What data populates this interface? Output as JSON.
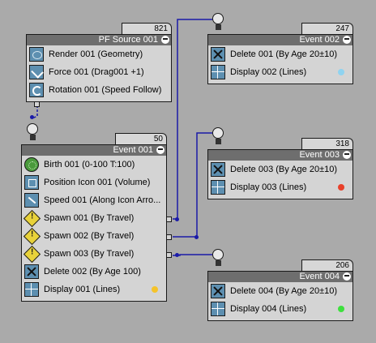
{
  "colors": {
    "background": "#aaaaaa",
    "node_body": "#d4d4d4",
    "title_bar": "#6e6e6e",
    "wire": "#1a1aa8",
    "display_001_dot": "#f5c32a",
    "display_002_dot": "#8fd3f0",
    "display_003_dot": "#e8402a",
    "display_004_dot": "#3ee03e"
  },
  "pf_source": {
    "count": "821",
    "title": "PF Source 001",
    "operators": [
      {
        "label": "Render 001 (Geometry)",
        "icon": "render-icon"
      },
      {
        "label": "Force 001 (Drag001 +1)",
        "icon": "force-icon"
      },
      {
        "label": "Rotation 001 (Speed Follow)",
        "icon": "rotation-icon"
      }
    ]
  },
  "event_001": {
    "count": "50",
    "title": "Event 001",
    "operators": [
      {
        "label": "Birth 001 (0-100 T:100)",
        "icon": "birth-icon"
      },
      {
        "label": "Position Icon 001 (Volume)",
        "icon": "position-icon"
      },
      {
        "label": "Speed 001 (Along Icon Arro...",
        "icon": "speed-icon"
      },
      {
        "label": "Spawn 001 (By Travel)",
        "icon": "spawn-icon"
      },
      {
        "label": "Spawn 002 (By Travel)",
        "icon": "spawn-icon"
      },
      {
        "label": "Spawn 003 (By Travel)",
        "icon": "spawn-icon"
      },
      {
        "label": "Delete 002 (By Age 100)",
        "icon": "delete-icon"
      },
      {
        "label": "Display 001 (Lines)",
        "icon": "display-icon"
      }
    ]
  },
  "event_002": {
    "count": "247",
    "title": "Event 002",
    "operators": [
      {
        "label": "Delete 001 (By Age 20±10)",
        "icon": "delete-icon"
      },
      {
        "label": "Display 002 (Lines)",
        "icon": "display-icon"
      }
    ]
  },
  "event_003": {
    "count": "318",
    "title": "Event 003",
    "operators": [
      {
        "label": "Delete 003 (By Age 20±10)",
        "icon": "delete-icon"
      },
      {
        "label": "Display 003 (Lines)",
        "icon": "display-icon"
      }
    ]
  },
  "event_004": {
    "count": "206",
    "title": "Event 004",
    "operators": [
      {
        "label": "Delete 004 (By Age 20±10)",
        "icon": "delete-icon"
      },
      {
        "label": "Display 004 (Lines)",
        "icon": "display-icon"
      }
    ]
  }
}
